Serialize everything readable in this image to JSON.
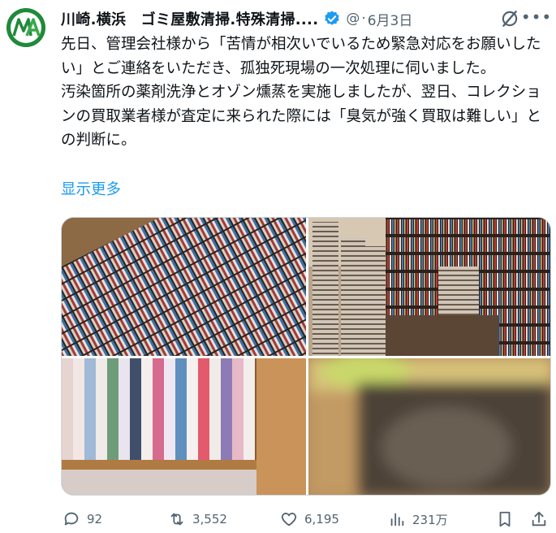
{
  "author": {
    "display_name": "川崎.横浜　ゴミ屋敷清掃.特殊清掃....",
    "handle": "@",
    "separator": "·",
    "date": "6月3日",
    "avatar_text": "MA"
  },
  "body": {
    "paragraph1": "先日、管理会社様から「苦情が相次いでいるため緊急対応をお願いしたい」とご連絡をいただき、孤独死現場の一次処理に伺いました。",
    "paragraph2": "汚染箇所の薬剤洗浄とオゾン燻蒸を実施しましたが、翌日、コレクションの買取業者様が査定に来られた際には「臭気が強く買取は難しい」との判断に。",
    "show_more": "显示更多"
  },
  "media": {
    "images": [
      {
        "name": "cd-shelf-wall",
        "colors": [
          "#6b4a2b",
          "#c9a57a"
        ]
      },
      {
        "name": "cluttered-cd-room",
        "colors": [
          "#3d2d22",
          "#b9a58c"
        ]
      },
      {
        "name": "dvd-spines-shelf",
        "colors": [
          "#8a5a2e",
          "#e6d9d4"
        ]
      },
      {
        "name": "blurred-floor",
        "colors": [
          "#c6a271",
          "#4a4138"
        ]
      }
    ]
  },
  "actions": {
    "reply_count": "92",
    "repost_count": "3,552",
    "like_count": "6,195",
    "view_count": "231万"
  },
  "colors": {
    "accent": "#1d9bf0",
    "muted": "#536471",
    "avatar_bg": "#1f8a3a"
  }
}
